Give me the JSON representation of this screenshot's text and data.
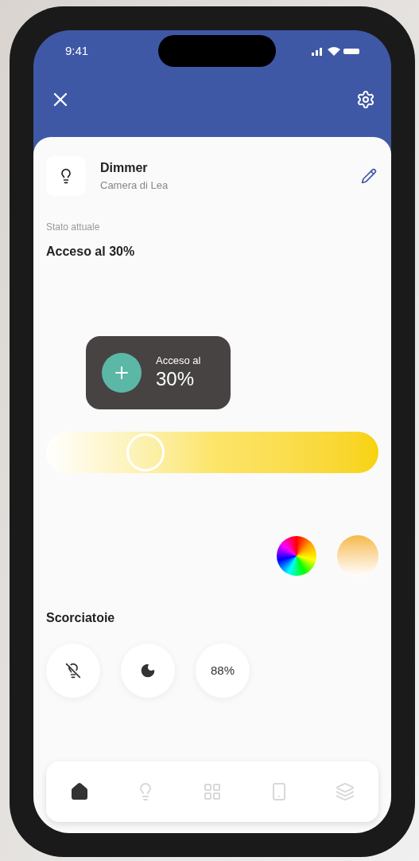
{
  "status_bar": {
    "time": "9:41"
  },
  "device": {
    "name": "Dimmer",
    "room": "Camera di Lea"
  },
  "state": {
    "label": "Stato attuale",
    "value": "Acceso al 30%"
  },
  "tooltip": {
    "line1": "Acceso al",
    "line2": "30%"
  },
  "slider": {
    "level": 0.3
  },
  "swatches": [
    {
      "kind": "wheel"
    },
    {
      "kind": "warm"
    }
  ],
  "shortcuts": {
    "title": "Scorciatoie",
    "items": [
      {
        "kind": "light-off"
      },
      {
        "kind": "moon"
      },
      {
        "kind": "text",
        "label": "88%"
      }
    ]
  },
  "nav": [
    {
      "kind": "home",
      "selected": true
    },
    {
      "kind": "bulb",
      "selected": false
    },
    {
      "kind": "grid",
      "selected": false
    },
    {
      "kind": "device",
      "selected": false
    },
    {
      "kind": "layers",
      "selected": false
    }
  ]
}
